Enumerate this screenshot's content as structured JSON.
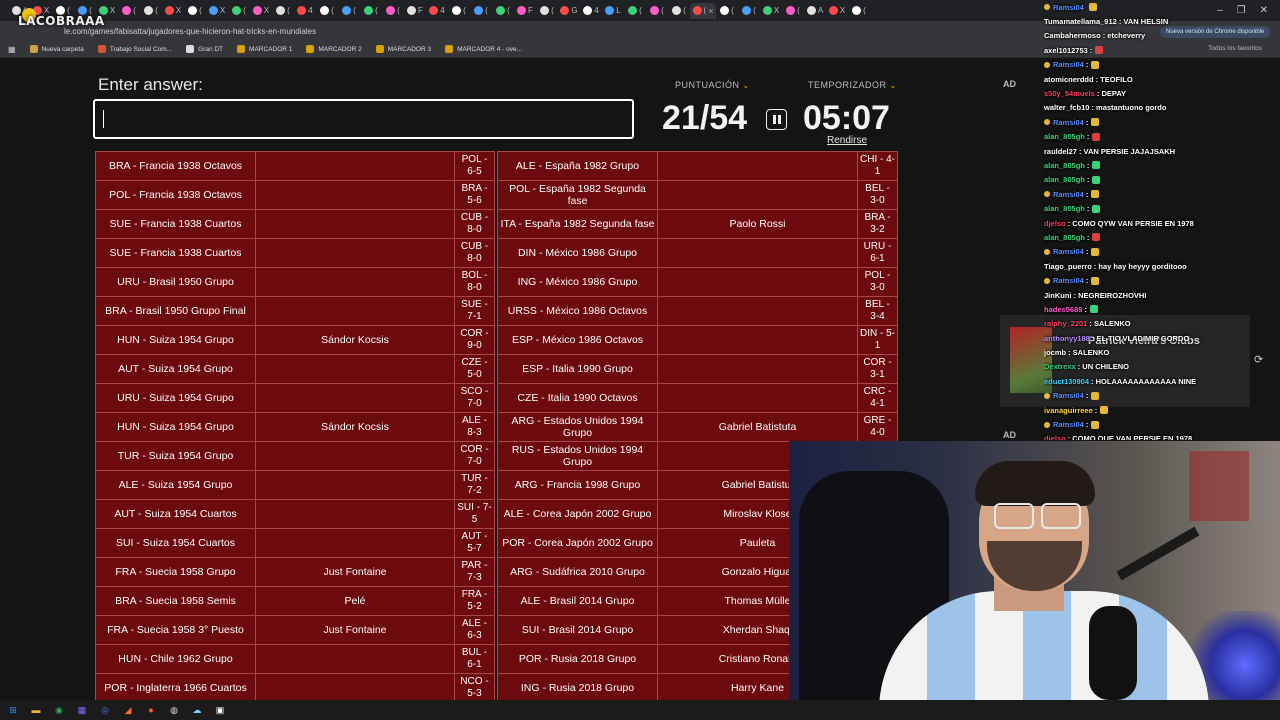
{
  "browser": {
    "tab_count": 39,
    "tab_labels": [
      "(",
      "X",
      "(",
      "(",
      "X",
      "(",
      "(",
      "X",
      "(",
      "X",
      "(",
      "X",
      "(",
      "4",
      "(",
      "(",
      "(",
      "(",
      "F",
      "4",
      "(",
      "(",
      "(",
      "F",
      "(",
      "G",
      "4",
      "L",
      "(",
      "(",
      "(",
      "(",
      "(",
      "(",
      "X",
      "(",
      "A",
      "X",
      "(",
      "X",
      "(",
      "A",
      "F"
    ],
    "active_tab_close": "×",
    "url": "le.com/games/fabisatta/jugadores-que-hicieron-hat-tricks-en-mundiales",
    "update_notice": "Nueva versión de Chrome disponible",
    "window_controls": [
      "–",
      "❐",
      "✕"
    ],
    "bookmarks": [
      {
        "label": "Nueva carpeta",
        "icon": "folder-icon",
        "color": "#c9a24a"
      },
      {
        "label": "Trabajo Social Com...",
        "icon": "bookmark-site-icon",
        "color": "#d9552d"
      },
      {
        "label": "Gran DT",
        "icon": "ball-icon",
        "color": "#dddddd"
      },
      {
        "label": "MARCADOR 1",
        "icon": "shield-icon",
        "color": "#d9a100"
      },
      {
        "label": "MARCADOR 2",
        "icon": "shield-icon",
        "color": "#d9a100"
      },
      {
        "label": "MARCADOR 3",
        "icon": "shield-icon",
        "color": "#d9a100"
      },
      {
        "label": "MARCADOR 4 - ove...",
        "icon": "shield-icon",
        "color": "#d9a100"
      }
    ],
    "all_bookmarks": "Todos los favoritos"
  },
  "overlay_logo": "LACOBRAAA",
  "quiz": {
    "enter_label": "Enter answer:",
    "answer_value": "",
    "score_label": "PUNTUACIÓN",
    "score_value": "21/54",
    "timer_label": "TEMPORIZADOR",
    "timer_value": "05:07",
    "give_up": "Rendirse",
    "ad_label": "AD"
  },
  "left_table": [
    {
      "match": "BRA - Francia 1938 Octavos",
      "player": "",
      "result": "POL - 6-5"
    },
    {
      "match": "POL - Francia 1938 Octavos",
      "player": "",
      "result": "BRA - 5-6"
    },
    {
      "match": "SUE - Francia 1938 Cuartos",
      "player": "",
      "result": "CUB - 8-0"
    },
    {
      "match": "SUE - Francia 1938 Cuartos",
      "player": "",
      "result": "CUB - 8-0"
    },
    {
      "match": "URU - Brasil 1950 Grupo",
      "player": "",
      "result": "BOL - 8-0"
    },
    {
      "match": "BRA - Brasil 1950 Grupo Final",
      "player": "",
      "result": "SUE - 7-1"
    },
    {
      "match": "HUN - Suiza 1954 Grupo",
      "player": "Sándor Kocsis",
      "result": "COR - 9-0"
    },
    {
      "match": "AUT - Suiza 1954 Grupo",
      "player": "",
      "result": "CZE - 5-0"
    },
    {
      "match": "URU - Suiza 1954 Grupo",
      "player": "",
      "result": "SCO - 7-0"
    },
    {
      "match": "HUN - Suiza 1954 Grupo",
      "player": "Sándor Kocsis",
      "result": "ALE - 8-3"
    },
    {
      "match": "TUR - Suiza 1954 Grupo",
      "player": "",
      "result": "COR - 7-0"
    },
    {
      "match": "ALE - Suiza 1954 Grupo",
      "player": "",
      "result": "TUR - 7-2"
    },
    {
      "match": "AUT - Suiza 1954 Cuartos",
      "player": "",
      "result": "SUI - 7-5"
    },
    {
      "match": "SUI - Suiza 1954 Cuartos",
      "player": "",
      "result": "AUT - 5-7"
    },
    {
      "match": "FRA - Suecia 1958 Grupo",
      "player": "Just Fontaine",
      "result": "PAR - 7-3"
    },
    {
      "match": "BRA - Suecia 1958 Semis",
      "player": "Pelé",
      "result": "FRA - 5-2"
    },
    {
      "match": "FRA - Suecia 1958 3° Puesto",
      "player": "Just Fontaine",
      "result": "ALE - 6-3"
    },
    {
      "match": "HUN - Chile 1962 Grupo",
      "player": "",
      "result": "BUL - 6-1"
    },
    {
      "match": "POR - Inglaterra 1966 Cuartos",
      "player": "",
      "result": "NCO - 5-3"
    }
  ],
  "right_table": [
    {
      "match": "ALE - España 1982 Grupo",
      "player": "",
      "result": "CHI - 4-1"
    },
    {
      "match": "POL - España 1982 Segunda fase",
      "player": "",
      "result": "BEL - 3-0"
    },
    {
      "match": "ITA - España 1982 Segunda fase",
      "player": "Paolo Rossi",
      "result": "BRA - 3-2"
    },
    {
      "match": "DIN - México 1986 Grupo",
      "player": "",
      "result": "URU - 6-1"
    },
    {
      "match": "ING - México 1986 Grupo",
      "player": "",
      "result": "POL - 3-0"
    },
    {
      "match": "URSS - México 1986 Octavos",
      "player": "",
      "result": "BEL - 3-4"
    },
    {
      "match": "ESP - México 1986 Octavos",
      "player": "",
      "result": "DIN - 5-1"
    },
    {
      "match": "ESP - Italia 1990 Grupo",
      "player": "",
      "result": "COR - 3-1"
    },
    {
      "match": "CZE - Italia 1990 Octavos",
      "player": "",
      "result": "CRC - 4-1"
    },
    {
      "match": "ARG - Estados Unidos 1994 Grupo",
      "player": "Gabriel Batistuta",
      "result": "GRE - 4-0"
    },
    {
      "match": "RUS - Estados Unidos 1994 Grupo",
      "player": "",
      "result": "CAM"
    },
    {
      "match": "ARG - Francia 1998 Grupo",
      "player": "Gabriel Batistut",
      "result": ""
    },
    {
      "match": "ALE - Corea Japón 2002 Grupo",
      "player": "Miroslav Klose",
      "result": ""
    },
    {
      "match": "POR - Corea Japón 2002 Grupo",
      "player": "Pauleta",
      "result": ""
    },
    {
      "match": "ARG - Sudáfrica 2010 Grupo",
      "player": "Gonzalo Higuai",
      "result": ""
    },
    {
      "match": "ALE - Brasil 2014 Grupo",
      "player": "Thomas Mülle",
      "result": ""
    },
    {
      "match": "SUI - Brasil 2014 Grupo",
      "player": "Xherdan Shaqi",
      "result": ""
    },
    {
      "match": "POR - Rusia 2018 Grupo",
      "player": "Cristiano Ronald",
      "result": ""
    },
    {
      "match": "ING - Rusia 2018 Grupo",
      "player": "Harry Kane",
      "result": ""
    }
  ],
  "chat": [
    {
      "user": "Ramsi04",
      "msg": "",
      "color": "#5b8cff",
      "badge": true,
      "emote": "#e4b93a"
    },
    {
      "user": "Tumamatellama_912",
      "msg": ": VAN HELSIN",
      "color": "#ffffff",
      "badge": false,
      "emote": ""
    },
    {
      "user": "Cambahermoso",
      "msg": ": etcheverry",
      "color": "#ffffff",
      "badge": false,
      "emote": ""
    },
    {
      "user": "axel1012753",
      "msg": ":",
      "color": "#ffffff",
      "badge": false,
      "emote": "#d94040"
    },
    {
      "user": "Ramsi04",
      "msg": ":",
      "color": "#5b8cff",
      "badge": true,
      "emote": "#e4b93a"
    },
    {
      "user": "atomicnerddd",
      "msg": ": TEOFILO",
      "color": "#ffffff",
      "badge": false,
      "emote": ""
    },
    {
      "user": "s50y_54muels",
      "msg": ": DEPAY",
      "color": "#ff3b5c",
      "badge": false,
      "emote": ""
    },
    {
      "user": "walter_fcb10",
      "msg": ": mastantuono gordo",
      "color": "#ffffff",
      "badge": false,
      "emote": ""
    },
    {
      "user": "Ramsi04",
      "msg": ":",
      "color": "#5b8cff",
      "badge": true,
      "emote": "#e4b93a"
    },
    {
      "user": "alan_805gh",
      "msg": ":",
      "color": "#3ed07a",
      "badge": false,
      "emote": "#d94040"
    },
    {
      "user": "rauldel27",
      "msg": ": VAN PERSIE JAJAJSAKH",
      "color": "#ffffff",
      "badge": false,
      "emote": ""
    },
    {
      "user": "alan_805gh",
      "msg": ":",
      "color": "#3ed07a",
      "badge": false,
      "emote": "#3ed07a"
    },
    {
      "user": "alan_805gh",
      "msg": ":",
      "color": "#3ed07a",
      "badge": false,
      "emote": "#3ed07a"
    },
    {
      "user": "Ramsi04",
      "msg": ":",
      "color": "#5b8cff",
      "badge": true,
      "emote": "#e4b93a"
    },
    {
      "user": "alan_805gh",
      "msg": ":",
      "color": "#3ed07a",
      "badge": false,
      "emote": "#3ed07a"
    },
    {
      "user": "djelso",
      "msg": ": COMO QYW VAN PERSIE EN 1978",
      "color": "#ff3b5c",
      "badge": false,
      "emote": ""
    },
    {
      "user": "alan_805gh",
      "msg": ":",
      "color": "#3ed07a",
      "badge": false,
      "emote": "#d94040"
    },
    {
      "user": "Ramsi04",
      "msg": ":",
      "color": "#5b8cff",
      "badge": true,
      "emote": "#e4b93a"
    },
    {
      "user": "Tiago_puerro",
      "msg": ": hay hay heyyy gorditooo",
      "color": "#ffffff",
      "badge": false,
      "emote": ""
    },
    {
      "user": "Ramsi04",
      "msg": ":",
      "color": "#5b8cff",
      "badge": true,
      "emote": "#e4b93a"
    },
    {
      "user": "JinKuni",
      "msg": ": NEGREIROZHOVHI",
      "color": "#ffffff",
      "badge": false,
      "emote": ""
    },
    {
      "user": "hades5689",
      "msg": ":",
      "color": "#ff5cc8",
      "badge": false,
      "emote": "#3ed07a"
    },
    {
      "user": "ralphy_2201",
      "msg": ": SALENKO",
      "color": "#ff3b5c",
      "badge": false,
      "emote": ""
    },
    {
      "user": "anthonyy188",
      "msg": ": EL TIO VLADIMIR GORDO",
      "color": "#b78bff",
      "badge": false,
      "emote": ""
    },
    {
      "user": "jocmb",
      "msg": ": SALENKO",
      "color": "#ffffff",
      "badge": false,
      "emote": ""
    },
    {
      "user": "Dextrexx",
      "msg": ": UN CHILENO",
      "color": "#3ed07a",
      "badge": false,
      "emote": ""
    },
    {
      "user": "educt130904",
      "msg": ": HOLAAAAAAAAAAAA NINE",
      "color": "#3ad7ff",
      "badge": false,
      "emote": ""
    },
    {
      "user": "Ramsi04",
      "msg": ":",
      "color": "#5b8cff",
      "badge": true,
      "emote": "#e4b93a"
    },
    {
      "user": "ivanaguirreee",
      "msg": ":",
      "color": "#ffd23a",
      "badge": false,
      "emote": "#e4b93a"
    },
    {
      "user": "Ramsi04",
      "msg": ":",
      "color": "#5b8cff",
      "badge": true,
      "emote": "#e4b93a"
    },
    {
      "user": "djelso",
      "msg": ": COMO QUE VAN PERSIE EN 1978",
      "color": "#ff3b5c",
      "badge": false,
      "emote": ""
    }
  ],
  "clip": {
    "title": "Patrick Vieira's Clubs",
    "refresh_icon": "refresh-icon"
  },
  "taskbar": [
    {
      "icon": "windows-start-icon",
      "color": "#3a8ee6",
      "glyph": "⊞"
    },
    {
      "icon": "file-explorer-icon",
      "color": "#e6b93a",
      "glyph": "▬"
    },
    {
      "icon": "chrome-icon",
      "color": "#34a853",
      "glyph": "◉"
    },
    {
      "icon": "apps-icon",
      "color": "#8a6bff",
      "glyph": "▦"
    },
    {
      "icon": "search-app-icon",
      "color": "#4d7cff",
      "glyph": "◎"
    },
    {
      "icon": "media-icon",
      "color": "#ff6a2a",
      "glyph": "◢"
    },
    {
      "icon": "browser-icon",
      "color": "#ff5a2a",
      "glyph": "●"
    },
    {
      "icon": "obs-icon",
      "color": "#dddddd",
      "glyph": "◍"
    },
    {
      "icon": "cloud-icon",
      "color": "#7ad0ff",
      "glyph": "☁"
    },
    {
      "icon": "terminal-icon",
      "color": "#ffffff",
      "glyph": "▣"
    }
  ]
}
